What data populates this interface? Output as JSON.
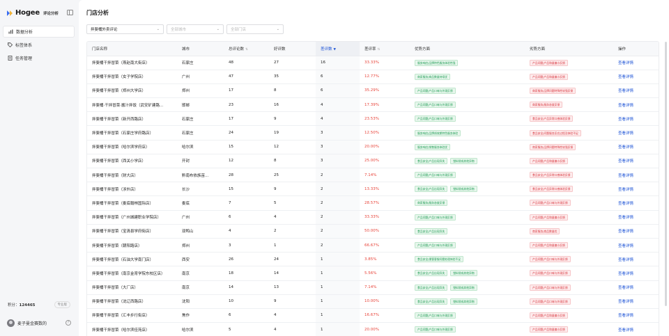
{
  "brand": {
    "name": "Hogee",
    "sub": "评论分析"
  },
  "nav": [
    {
      "label": "数据分析",
      "icon": "chart-icon",
      "active": true
    },
    {
      "label": "标签体系",
      "icon": "tag-icon",
      "active": false
    },
    {
      "label": "任务管理",
      "icon": "task-icon",
      "active": false
    }
  ],
  "points": {
    "label": "积分：",
    "value": "124465",
    "badge": "专业版"
  },
  "user": {
    "name": "麦子曼金赛数的"
  },
  "page": {
    "title": "门店分析"
  },
  "filters": {
    "platform": "拌斐桶外卖评论",
    "city_placeholder": "全部城市",
    "store_placeholder": "全部门店"
  },
  "columns": [
    "门店名称",
    "城市",
    "总评论数",
    "好评数",
    "差评数",
    "差评率",
    "优势方面",
    "劣势方面",
    "操作"
  ],
  "action_label": "查看详情",
  "accent_color": "#1e54d6",
  "bad_color": "#e8443a",
  "rows": [
    {
      "name": "拌斐桶干拌冒菜（燕赵南大街店）",
      "city": "石家庄",
      "total": "48",
      "good": "27",
      "bad": "16",
      "rate": "33.33%",
      "pros": [
        "服务响应|品牌特色服务体验性强"
      ],
      "cons": [
        "产品问题|产品和量偏小反馈"
      ]
    },
    {
      "name": "拌斐桶干拌冒菜（女子学院店）",
      "city": "广州",
      "total": "47",
      "good": "35",
      "bad": "6",
      "rate": "12.77%",
      "pros": [
        "商家服务|商品数量持续优"
      ],
      "cons": [
        "产品问题|产品和量偏小反馈"
      ]
    },
    {
      "name": "拌斐桶干拌冒菜（郑州大学店）",
      "city": "郑州",
      "total": "17",
      "good": "8",
      "bad": "6",
      "rate": "35.29%",
      "pros": [
        "产品问题|产品口味与外观反馈"
      ],
      "cons": [
        "商家服务|品牌问题特殊性较强反馈"
      ]
    },
    {
      "name": "拌斐桶·干拌冒菜·酱汁拌饭（武安矿建路...",
      "city": "邯郸",
      "total": "23",
      "good": "16",
      "bad": "4",
      "rate": "17.39%",
      "pros": [
        "产品问题|产品口味与外观反馈"
      ],
      "cons": [
        "商家服务|服务态度反馈"
      ]
    },
    {
      "name": "拌斐桶干拌冒菜（新开西路店）",
      "city": "石家庄",
      "total": "17",
      "good": "9",
      "bad": "4",
      "rate": "23.53%",
      "pros": [
        "产品问题|产品口味与外观反馈"
      ],
      "cons": [
        "食品安全|产品异常口感体验反馈"
      ]
    },
    {
      "name": "拌斐桶干拌冒菜（石家庄学府路店）",
      "city": "石家庄",
      "total": "24",
      "good": "19",
      "bad": "3",
      "rate": "12.50%",
      "pros": [
        "服务响应|品牌线效期特色服务体验"
      ],
      "cons": [
        "食品安全|问题服务反应过程及体验不足"
      ]
    },
    {
      "name": "拌斐桶干拌冒菜（哈尔滨学府店）",
      "city": "哈尔滨",
      "total": "15",
      "good": "12",
      "bad": "3",
      "rate": "20.00%",
      "pros": [
        "服务响应|销售服务体验优"
      ],
      "cons": [
        "商家服务|品牌问题特殊性较强反馈"
      ]
    },
    {
      "name": "拌斐桶干拌冒菜（西关小学店）",
      "city": "开封",
      "total": "12",
      "good": "8",
      "bad": "3",
      "rate": "25.00%",
      "pros": [
        "食品安全|产品出现异失",
        "塑料袋成其他异物"
      ],
      "cons": [
        "产品问题|产品和量偏小反馈"
      ]
    },
    {
      "name": "拌斐桶干拌冒菜（财大店）",
      "city": "黔南布依族苗...",
      "total": "28",
      "good": "25",
      "bad": "2",
      "rate": "7.14%",
      "pros": [
        "产品问题|产品口味与外观反馈"
      ],
      "cons": [
        "食品安全|产品异常口感体验反馈"
      ]
    },
    {
      "name": "拌斐桶干拌冒菜（涉外店）",
      "city": "长沙",
      "total": "15",
      "good": "9",
      "bad": "2",
      "rate": "13.33%",
      "pros": [
        "食品安全|产品出现异失",
        "塑料袋成其他异物"
      ],
      "cons": [
        "食品安全|产品异常口感体验反馈"
      ]
    },
    {
      "name": "拌斐桶干拌冒菜（娄底翰林国际店）",
      "city": "娄底",
      "total": "7",
      "good": "5",
      "bad": "2",
      "rate": "28.57%",
      "pros": [
        "商家服务|服务态度反馈"
      ],
      "cons": [
        "产品问题|产品口味与外观反馈"
      ]
    },
    {
      "name": "拌斐桶干拌冒菜（广州城建职业学院店）",
      "city": "广州",
      "total": "6",
      "good": "4",
      "bad": "2",
      "rate": "33.33%",
      "pros": [
        "产品问题|产品口味与外观反馈"
      ],
      "cons": [
        "产品问题|产品和量偏小反馈"
      ]
    },
    {
      "name": "拌斐桶干拌冒菜（宝清县学府街店）",
      "city": "双鸭山",
      "total": "4",
      "good": "2",
      "bad": "2",
      "rate": "50.00%",
      "pros": [
        "食品安全|产品出现异失"
      ],
      "cons": [
        "商家服务|商品数量优"
      ]
    },
    {
      "name": "拌斐桶干拌冒菜（朝阳路店）",
      "city": "郑州",
      "total": "3",
      "good": "1",
      "bad": "2",
      "rate": "66.67%",
      "pros": [
        "产品问题|产品口味与外观反馈"
      ],
      "cons": [
        "产品问题|产品和量偏小反馈"
      ]
    },
    {
      "name": "拌斐桶干拌冒菜（石油大学南门店）",
      "city": "西安",
      "total": "26",
      "good": "24",
      "bad": "1",
      "rate": "3.85%",
      "pros": [
        "食品安全|便客客服问题处理体验不足"
      ],
      "cons": [
        "产品问题|产品口味与外观反馈"
      ]
    },
    {
      "name": "拌斐桶干拌冒菜（南京金育学院东校区店）",
      "city": "南京",
      "total": "18",
      "good": "14",
      "bad": "1",
      "rate": "5.56%",
      "pros": [
        "食品安全|产品出现异失",
        "塑料袋成其他异物"
      ],
      "cons": [
        "产品问题|产品口味与外观反馈"
      ]
    },
    {
      "name": "拌斐桶干拌冒菜（大厂店）",
      "city": "南京",
      "total": "14",
      "good": "13",
      "bad": "1",
      "rate": "7.14%",
      "pros": [
        "食品安全|产品出现异失",
        "塑料袋成其他异物"
      ],
      "cons": [
        "产品问题|产品口味与外观反馈"
      ]
    },
    {
      "name": "拌斐桶干拌冒菜（沈辽西路店）",
      "city": "沈阳",
      "total": "10",
      "good": "9",
      "bad": "1",
      "rate": "10.00%",
      "pros": [
        "食品安全|产品出现异失",
        "塑料袋成其他异物"
      ],
      "cons": [
        "产品问题|产品口味与外观反馈"
      ]
    },
    {
      "name": "拌斐桶干拌冒菜（汇丰步行街店）",
      "city": "焦作",
      "total": "6",
      "good": "4",
      "bad": "1",
      "rate": "16.67%",
      "pros": [
        "产品问题|产品口味与外观反馈"
      ],
      "cons": [
        "产品问题|产品和量偏小反馈"
      ]
    },
    {
      "name": "拌斐桶干拌冒菜（哈尔滨佳苑店）",
      "city": "哈尔滨",
      "total": "5",
      "good": "4",
      "bad": "1",
      "rate": "20.00%",
      "pros": [
        "产品问题|产品口味与外观反馈"
      ],
      "cons": [
        "产品问题|产品和量偏小反馈"
      ]
    }
  ]
}
